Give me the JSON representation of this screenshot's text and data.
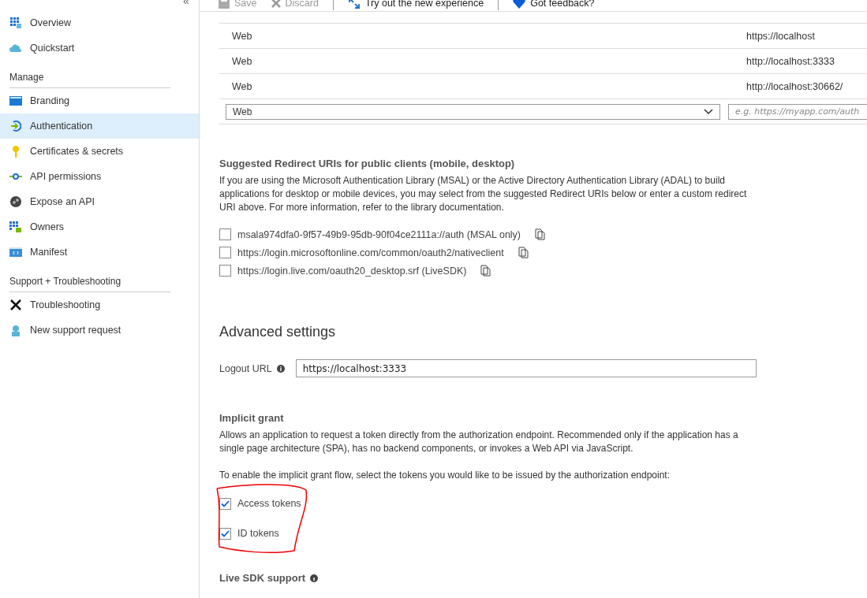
{
  "sidebar": {
    "collapse": "«",
    "groups": [
      {
        "items": [
          {
            "label": "Overview",
            "selected": false
          },
          {
            "label": "Quickstart",
            "selected": false
          }
        ]
      },
      {
        "title": "Manage",
        "items": [
          {
            "label": "Branding",
            "selected": false
          },
          {
            "label": "Authentication",
            "selected": true
          },
          {
            "label": "Certificates & secrets",
            "selected": false
          },
          {
            "label": "API permissions",
            "selected": false
          },
          {
            "label": "Expose an API",
            "selected": false
          },
          {
            "label": "Owners",
            "selected": false
          },
          {
            "label": "Manifest",
            "selected": false
          }
        ]
      },
      {
        "title": "Support + Troubleshooting",
        "items": [
          {
            "label": "Troubleshooting",
            "selected": false
          },
          {
            "label": "New support request",
            "selected": false
          }
        ]
      }
    ]
  },
  "toolbar": [
    {
      "label": "Save",
      "disabled": true
    },
    {
      "label": "Discard",
      "disabled": true
    },
    {
      "label": "Try out the new experience",
      "disabled": false
    },
    {
      "label": "Got feedback?",
      "disabled": false
    }
  ],
  "redirect_table": {
    "rows": [
      {
        "type": "Web",
        "uri": "https://localhost"
      },
      {
        "type": "Web",
        "uri": "http://localhost:3333"
      },
      {
        "type": "Web",
        "uri": "http://localhost:30662/"
      }
    ],
    "new_row": {
      "type": "Web",
      "placeholder": "e.g. https://myapp.com/auth"
    }
  },
  "suggested": {
    "title": "Suggested Redirect URIs for public clients (mobile, desktop)",
    "description": "If you are using the Microsoft Authentication Library (MSAL) or the Active Directory Authentication Library (ADAL) to build applications for desktop or mobile devices, you may select from the suggested Redirect URIs below or enter a custom redirect URI above. For more information, refer to the library documentation.",
    "uris": [
      {
        "label": "msala974dfa0-9f57-49b9-95db-90f04ce2111a://auth (MSAL only)",
        "checked": false
      },
      {
        "label": "https://login.microsoftonline.com/common/oauth2/nativeclient",
        "checked": false
      },
      {
        "label": "https://login.live.com/oauth20_desktop.srf (LiveSDK)",
        "checked": false
      }
    ]
  },
  "advanced": {
    "title": "Advanced settings",
    "logout_label": "Logout URL",
    "logout_value": "https://localhost:3333",
    "implicit_title": "Implicit grant",
    "implicit_description": "Allows an application to request a token directly from the authorization endpoint. Recommended only if the application has a single page architecture (SPA), has no backend components, or invokes a Web API via JavaScript.",
    "implicit_prompt": "To enable the implicit grant flow, select the tokens you would like to be issued by the authorization endpoint:",
    "tokens": [
      {
        "label": "Access tokens",
        "checked": true
      },
      {
        "label": "ID tokens",
        "checked": true
      }
    ],
    "live_sdk_title": "Live SDK support"
  }
}
